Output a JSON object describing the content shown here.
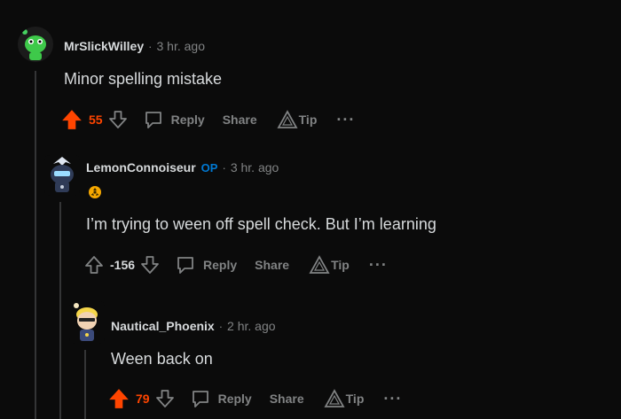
{
  "comments": [
    {
      "username": "MrSlickWilley",
      "op_badge": "",
      "separator": "·",
      "time": "3 hr. ago",
      "body": "Minor spelling mistake",
      "score": "55",
      "vote_state": "upvoted",
      "reply_label": "Reply",
      "share_label": "Share",
      "tip_label": "Tip",
      "more_label": "···",
      "avatar_color": "#3ec94a"
    },
    {
      "username": "LemonConnoiseur",
      "op_badge": "OP",
      "separator": "·",
      "time": "3 hr. ago",
      "body": "I’m trying to ween off spell check. But I’m learning",
      "score": "-156",
      "vote_state": "none",
      "reply_label": "Reply",
      "share_label": "Share",
      "tip_label": "Tip",
      "more_label": "···",
      "avatar_color": "#2f3b57"
    },
    {
      "username": "Nautical_Phoenix",
      "op_badge": "",
      "separator": "·",
      "time": "2 hr. ago",
      "body": "Ween back on",
      "score": "79",
      "vote_state": "upvoted",
      "reply_label": "Reply",
      "share_label": "Share",
      "tip_label": "Tip",
      "more_label": "···",
      "avatar_color": "#f5d64a"
    }
  ],
  "colors": {
    "upvote": "#ff4500",
    "op": "#0079d3",
    "muted": "#818384",
    "text": "#d7dadc",
    "background": "#0b0b0b"
  }
}
